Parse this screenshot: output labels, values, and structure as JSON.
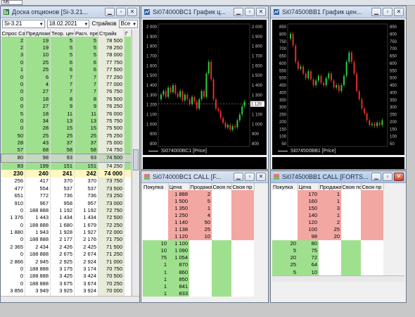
{
  "taskbar": {
    "mini_label": "M5"
  },
  "options_window": {
    "title": "Доска опционов [Si-3.21...",
    "instrument": "Si-3.21",
    "date": "18.02.2021",
    "strikes_label": "Страйков",
    "strikes_value": "Все",
    "columns": [
      "Спрос Cal",
      "Предложени",
      "Теор. цена",
      "Расч. прем",
      "Страйк",
      "Г"
    ],
    "rows_up": [
      [
        "2",
        "19",
        "5",
        "5",
        "78 500"
      ],
      [
        "2",
        "19",
        "5",
        "5",
        "78 250"
      ],
      [
        "3",
        "10",
        "5",
        "5",
        "78 000"
      ],
      [
        "0",
        "25",
        "6",
        "6",
        "77 750"
      ],
      [
        "1",
        "25",
        "6",
        "6",
        "77 500"
      ],
      [
        "0",
        "6",
        "7",
        "7",
        "77 250"
      ],
      [
        "0",
        "4",
        "7",
        "7",
        "77 000"
      ],
      [
        "0",
        "27",
        "7",
        "7",
        "76 750"
      ],
      [
        "0",
        "18",
        "8",
        "8",
        "76 500"
      ],
      [
        "0",
        "27",
        "9",
        "9",
        "76 250"
      ],
      [
        "5",
        "18",
        "11",
        "11",
        "76 000"
      ],
      [
        "0",
        "34",
        "13",
        "13",
        "75 750"
      ],
      [
        "0",
        "28",
        "15",
        "15",
        "75 500"
      ],
      [
        "50",
        "25",
        "25",
        "25",
        "75 250"
      ],
      [
        "28",
        "43",
        "37",
        "37",
        "75 000"
      ],
      [
        "57",
        "68",
        "58",
        "58",
        "74 750"
      ]
    ],
    "row_selected": [
      "80",
      "98",
      "93",
      "93",
      "74 500"
    ],
    "row_last_up": [
      "83",
      "199",
      "151",
      "151",
      "74 250"
    ],
    "row_center": [
      "230",
      "240",
      "241",
      "242",
      "74 000"
    ],
    "rows_down": [
      [
        "256",
        "417",
        "370",
        "370",
        "73 750"
      ],
      [
        "477",
        "554",
        "537",
        "537",
        "73 500"
      ],
      [
        "651",
        "772",
        "736",
        "736",
        "73 250"
      ],
      [
        "910",
        "967",
        "958",
        "957",
        "73 000"
      ],
      [
        "0",
        "188 888",
        "1 192",
        "1 192",
        "72 750"
      ],
      [
        "1 376",
        "1 443",
        "1 434",
        "1 434",
        "72 500"
      ],
      [
        "0",
        "188 888",
        "1 680",
        "1 679",
        "72 250"
      ],
      [
        "1 880",
        "1 943",
        "1 928",
        "1 927",
        "72 000"
      ],
      [
        "0",
        "188 888",
        "2 177",
        "2 176",
        "71 750"
      ],
      [
        "2 365",
        "2 434",
        "2 426",
        "2 425",
        "71 500"
      ],
      [
        "0",
        "188 888",
        "2 675",
        "2 674",
        "71 250"
      ],
      [
        "2 866",
        "2 945",
        "2 925",
        "2 924",
        "71 000"
      ],
      [
        "0",
        "188 888",
        "3 175",
        "3 174",
        "70 750"
      ],
      [
        "0",
        "188 888",
        "3 425",
        "3 424",
        "70 500"
      ],
      [
        "0",
        "188 888",
        "3 675",
        "3 674",
        "70 250"
      ],
      [
        "3 856",
        "3 949",
        "3 925",
        "3 924",
        "70 000"
      ],
      [
        "0",
        "188 888",
        "4 175",
        "4 174",
        "69 750"
      ]
    ]
  },
  "chart1": {
    "title": "Si074000BC1 График ц...",
    "legend": "Si074000BC1 [Price]",
    "last_price_label": "1 120",
    "left_ticks": [
      "2 000",
      "1 900",
      "1 800",
      "1 700",
      "1 600",
      "1 500",
      "1 400",
      "1 300",
      "1 200",
      "1 100",
      "1 000",
      "900",
      "800"
    ],
    "right_ticks": [
      "2 000",
      "1 900",
      "1 800",
      "1 700",
      "1 600",
      "1 500",
      "1 400",
      "1 300",
      "1 200",
      "1 100",
      "1 000",
      "900",
      "800"
    ]
  },
  "chart2": {
    "title": "Si074500BB1 График цен...",
    "legend": "Si074500BB1 [Price]",
    "left_ticks": [
      "850",
      "800",
      "750",
      "700",
      "650",
      "600",
      "550",
      "500",
      "450",
      "400",
      "350",
      "300",
      "250",
      "200",
      "150",
      "100",
      "50"
    ],
    "right_ticks": [
      "850",
      "800",
      "750",
      "700",
      "650",
      "600",
      "550",
      "500",
      "450",
      "400",
      "350",
      "300",
      "250",
      "200",
      "150",
      "100",
      "50"
    ]
  },
  "book1": {
    "title": "Si074000BC1 CALL [F...",
    "columns": [
      "Покупка",
      "Цена",
      "Продажа",
      "Своя по",
      "Своя пр"
    ],
    "asks": [
      [
        "1 888",
        "2"
      ],
      [
        "1 500",
        "5"
      ],
      [
        "1 350",
        "1"
      ],
      [
        "1 250",
        "4"
      ],
      [
        "1 140",
        "50"
      ],
      [
        "1 138",
        "25"
      ],
      [
        "1 120",
        "10"
      ]
    ],
    "bids": [
      [
        "10",
        "1 100"
      ],
      [
        "10",
        "1 090"
      ],
      [
        "75",
        "1 054"
      ],
      [
        "1",
        "870"
      ],
      [
        "1",
        "860"
      ],
      [
        "1",
        "850"
      ],
      [
        "1",
        "841"
      ],
      [
        "1",
        "833"
      ]
    ]
  },
  "book2": {
    "title": "Si074500BB1 CALL [FORTS...",
    "columns": [
      "Покупка",
      "Цена",
      "Продажа",
      "Своя по",
      "Своя пр"
    ],
    "asks": [
      [
        "170",
        "1"
      ],
      [
        "160",
        "1"
      ],
      [
        "150",
        "3"
      ],
      [
        "140",
        "1"
      ],
      [
        "120",
        "2"
      ],
      [
        "100",
        "25"
      ],
      [
        "98",
        "20"
      ]
    ],
    "bids": [
      [
        "20",
        "80"
      ],
      [
        "5",
        "75"
      ],
      [
        "20",
        "72"
      ],
      [
        "25",
        "64"
      ],
      [
        "5",
        "10"
      ]
    ]
  },
  "colors": {
    "up": "#9fe08f",
    "sell": "#f2a7a3",
    "chart_bg": "#000000",
    "candle_up": "#2ecc40",
    "candle_dn": "#e03030"
  },
  "icons": [
    "window-app-icon",
    "minimize-icon",
    "restore-icon",
    "close-icon",
    "dropdown-arrow-icon"
  ]
}
